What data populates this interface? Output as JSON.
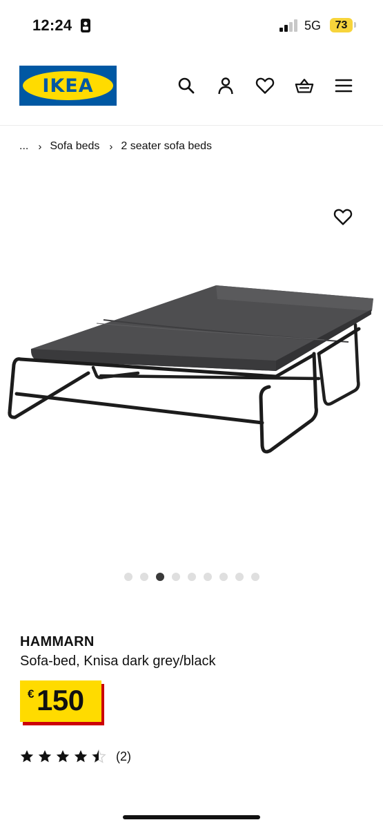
{
  "status_bar": {
    "time": "12:24",
    "network": "5G",
    "battery": "73"
  },
  "header": {
    "logo_text": "IKEA",
    "brand_colors": {
      "blue": "#0058a3",
      "yellow": "#ffdb00"
    },
    "icons": [
      "search-icon",
      "account-icon",
      "favourites-icon",
      "basket-icon",
      "menu-icon"
    ]
  },
  "breadcrumb": {
    "ellipsis": "...",
    "items": [
      "Sofa beds",
      "2 seater sofa beds"
    ]
  },
  "gallery": {
    "image_count": 9,
    "active_index": 2
  },
  "product": {
    "name": "HAMMARN",
    "description": "Sofa-bed, Knisa dark grey/black",
    "price_currency": "€",
    "price_value": "150",
    "rating_stars": 4.5,
    "rating_count": "(2)"
  }
}
